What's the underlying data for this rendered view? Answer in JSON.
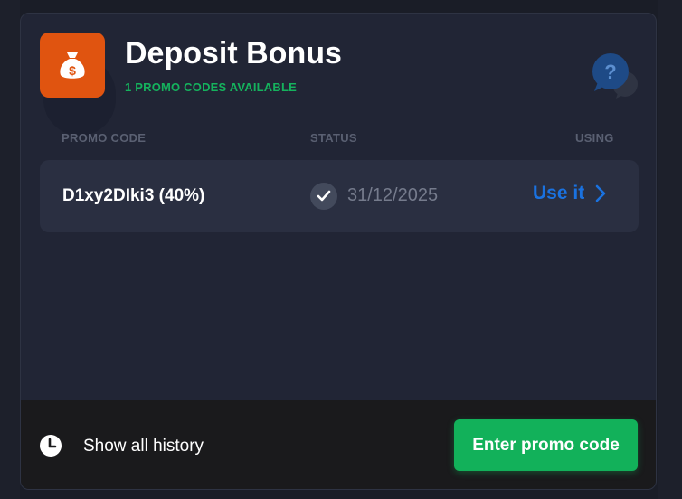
{
  "header": {
    "title": "Deposit Bonus",
    "subtitle": "1 PROMO CODES AVAILABLE"
  },
  "table": {
    "columns": [
      "PROMO CODE",
      "STATUS",
      "USING"
    ],
    "rows": [
      {
        "code": "D1xy2DIki3 (40%)",
        "date": "31/12/2025",
        "action": "Use it"
      }
    ]
  },
  "footer": {
    "history_label": "Show all history",
    "enter_button": "Enter promo code"
  },
  "colors": {
    "accent_orange": "#e05410",
    "accent_green": "#15b25d",
    "link_blue": "#1a72e0",
    "help_blue": "#1e4a86"
  },
  "icons": {
    "money_bag": "money-bag-icon",
    "help": "help-question-icon",
    "check": "check-icon",
    "chevron": "chevron-right-icon",
    "clock": "clock-icon"
  }
}
